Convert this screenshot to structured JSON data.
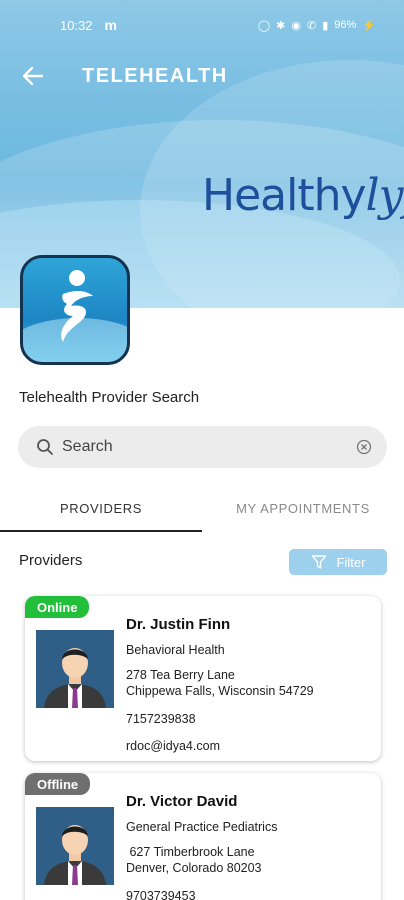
{
  "status_bar": {
    "time": "10:32",
    "notification": "m",
    "battery": "96%"
  },
  "app_bar": {
    "title": "TELEHEALTH"
  },
  "brand": {
    "part1": "Healthy",
    "part2": "lyf",
    "color": "#1d4f9b"
  },
  "page": {
    "section_title": "Telehealth Provider Search"
  },
  "search": {
    "placeholder": "Search"
  },
  "tabs": [
    {
      "label": "PROVIDERS",
      "active": true
    },
    {
      "label": "MY APPOINTMENTS",
      "active": false
    }
  ],
  "providers_section": {
    "label": "Providers",
    "filter_label": "Filter"
  },
  "providers": [
    {
      "status": "Online",
      "status_color": "#22c03a",
      "name": "Dr. Justin Finn",
      "specialty": "Behavioral Health",
      "address_line1": "278 Tea Berry Lane",
      "address_line2": "Chippewa Falls, Wisconsin 54729",
      "phone": "7157239838",
      "email": "rdoc@idya4.com"
    },
    {
      "status": "Offline",
      "status_color": "#6f6f6f",
      "name": "Dr. Victor David",
      "specialty": "General Practice Pediatrics",
      "address_line1": " 627 Timberbrook Lane",
      "address_line2": "Denver, Colorado 80203",
      "phone": "9703739453",
      "email": ""
    }
  ]
}
